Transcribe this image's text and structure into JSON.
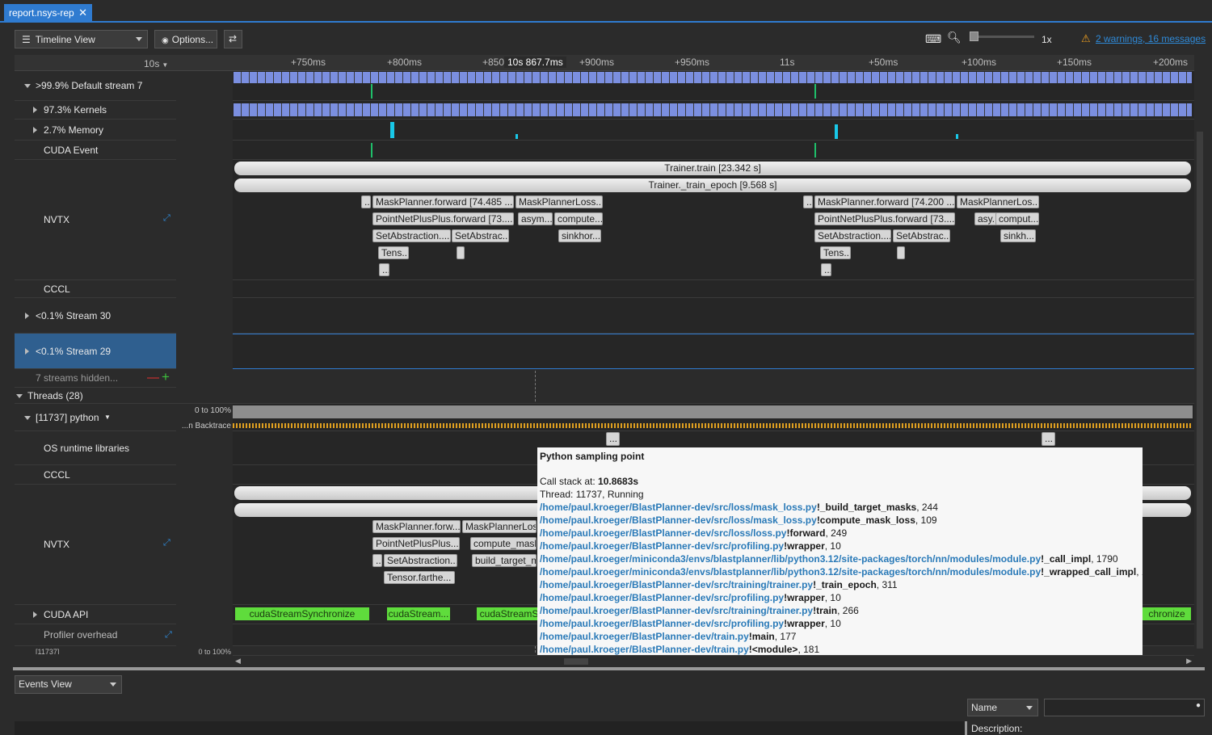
{
  "tab": {
    "title": "report.nsys-rep",
    "close": "✕"
  },
  "toolbar": {
    "view": "Timeline View",
    "options": "Options...",
    "zoom_level": "1x",
    "warnings": "2 warnings, 16 messages"
  },
  "ruler": {
    "scale": "10s",
    "cursor": "10s 867.7ms",
    "ticks": [
      "+750ms",
      "+800ms",
      "+850",
      "+900ms",
      "+950ms",
      "11s",
      "+50ms",
      "+100ms",
      "+150ms",
      "+200ms"
    ]
  },
  "rows": {
    "default_stream": ">99.9% Default stream 7",
    "kernels": "97.3% Kernels",
    "memory": "2.7% Memory",
    "cuda_event": "CUDA Event",
    "nvtx": "NVTX",
    "cccl": "CCCL",
    "stream30": "<0.1% Stream 30",
    "stream29": "<0.1% Stream 29",
    "hidden": "7 streams hidden...",
    "threads": "Threads (28)",
    "python": "[11737] python",
    "util": "0 to 100%",
    "backtrace": "...n Backtrace",
    "os_runtime": "OS runtime libraries",
    "cccl2": "CCCL",
    "nvtx2": "NVTX",
    "cuda_api": "CUDA API",
    "profiler": "Profiler overhead",
    "cut_label": "[11737]",
    "cut_util": "0 to 100%"
  },
  "nvtx_ranges": {
    "train": "Trainer.train [23.342 s]",
    "epoch": "Trainer._train_epoch [9.568 s]",
    "dots": "...",
    "mp_fwd1": "MaskPlanner.forward [74.485 ...",
    "mp_loss1": "MaskPlannerLoss...",
    "pnp1": "PointNetPlusPlus.forward [73....",
    "asym1": "asym...",
    "compute1": "compute...",
    "sa1": "SetAbstraction....",
    "sa2": "SetAbstrac...",
    "sink1": "sinkhor...",
    "tens1": "Tens...",
    "mp_fwd2": "MaskPlanner.forward [74.200 ...",
    "mp_loss2": "MaskPlannerLos...",
    "pnp2": "PointNetPlusPlus.forward [73....",
    "asym2": "asy...",
    "compute2": "comput...",
    "sa3": "SetAbstraction....",
    "sa4": "SetAbstrac...",
    "sink2": "sinkh...",
    "tens2": "Tens..."
  },
  "thread_nvtx": {
    "mp_fwd": "MaskPlanner.forw...",
    "mp_loss": "MaskPlannerLos",
    "pnp": "PointNetPlusPlus...",
    "compute": "compute_mask",
    "dots": "...",
    "sa": "SetAbstraction...",
    "btm": "build_target_m",
    "tensor": "Tensor.farthe..."
  },
  "cuda_api_calls": {
    "c1": "cudaStreamSynchronize",
    "c2": "cudaStream...",
    "c3": "cudaStreamS",
    "c4": "chronize"
  },
  "tooltip": {
    "title": "Python sampling point",
    "callstack_label": "Call stack at: ",
    "callstack_value": "10.8683s",
    "thread": "Thread: 11737, Running",
    "frames": [
      {
        "path": "/home/paul.kroeger/BlastPlanner-dev/src/loss/mask_loss.py",
        "fn": "!_build_target_masks",
        "line": ", 244"
      },
      {
        "path": "/home/paul.kroeger/BlastPlanner-dev/src/loss/mask_loss.py",
        "fn": "!compute_mask_loss",
        "line": ", 109"
      },
      {
        "path": "/home/paul.kroeger/BlastPlanner-dev/src/loss/loss.py",
        "fn": "!forward",
        "line": ", 249"
      },
      {
        "path": "/home/paul.kroeger/BlastPlanner-dev/src/profiling.py",
        "fn": "!wrapper",
        "line": ", 10"
      },
      {
        "path": "/home/paul.kroeger/miniconda3/envs/blastplanner/lib/python3.12/site-packages/torch/nn/modules/module.py",
        "fn": "!_call_impl",
        "line": ", 1790"
      },
      {
        "path": "/home/paul.kroeger/miniconda3/envs/blastplanner/lib/python3.12/site-packages/torch/nn/modules/module.py",
        "fn": "!_wrapped_call_impl",
        "line": ", 1779"
      },
      {
        "path": "/home/paul.kroeger/BlastPlanner-dev/src/training/trainer.py",
        "fn": "!_train_epoch",
        "line": ", 311"
      },
      {
        "path": "/home/paul.kroeger/BlastPlanner-dev/src/profiling.py",
        "fn": "!wrapper",
        "line": ", 10"
      },
      {
        "path": "/home/paul.kroeger/BlastPlanner-dev/src/training/trainer.py",
        "fn": "!train",
        "line": ", 266"
      },
      {
        "path": "/home/paul.kroeger/BlastPlanner-dev/src/profiling.py",
        "fn": "!wrapper",
        "line": ", 10"
      },
      {
        "path": "/home/paul.kroeger/BlastPlanner-dev/train.py",
        "fn": "!main",
        "line": ", 177"
      },
      {
        "path": "/home/paul.kroeger/BlastPlanner-dev/train.py",
        "fn": "!<module>",
        "line": ", 181"
      }
    ]
  },
  "bottom": {
    "events_view": "Events View",
    "name_filter": "Name",
    "description": "Description:"
  },
  "colors": {
    "accent": "#2f7bd0",
    "kernel": "#7b8fe0",
    "memory": "#19c8e8",
    "cuda_api": "#5fdc3c",
    "selected": "#2f5f8f"
  }
}
